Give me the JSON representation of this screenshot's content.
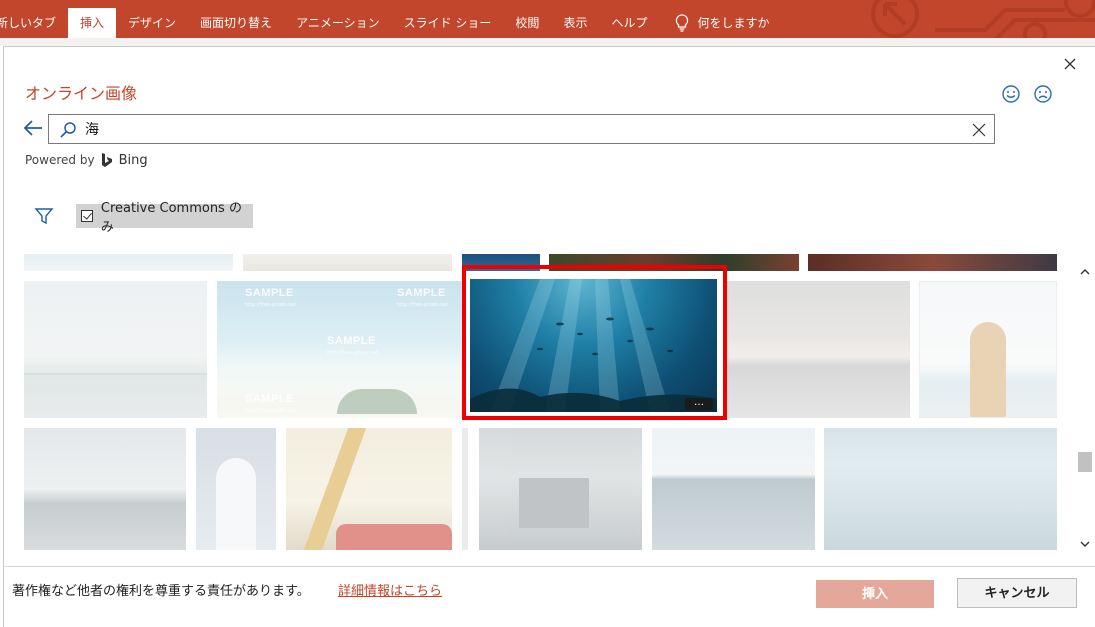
{
  "ribbon": {
    "tabs": [
      "新しいタブ",
      "挿入",
      "デザイン",
      "画面切り替え",
      "アニメーション",
      "スライド ショー",
      "校閲",
      "表示",
      "ヘルプ"
    ],
    "active_tab": "挿入",
    "tell_me": "何をしますか",
    "tell_me_icon": "lightbulb-icon",
    "accent_color": "#c2462b"
  },
  "dialog": {
    "title": "オンライン画像",
    "close_icon": "close-icon",
    "feedback_icons": [
      "smile-icon",
      "frown-icon"
    ],
    "search": {
      "value": "海",
      "placeholder": "",
      "icons": [
        "back-arrow-icon",
        "search-icon",
        "clear-icon"
      ]
    },
    "powered_by_label": "Powered by",
    "powered_by_brand": "Bing",
    "filter": {
      "icon": "filter-icon",
      "creative_commons_label": "Creative Commons のみ",
      "creative_commons_checked": true
    },
    "results": {
      "sample_watermark": "SAMPLE",
      "sample_url": "http://free-photo.net",
      "selected_index": 7,
      "more_button_label": "…",
      "highlight_color": "#ee0000"
    },
    "footer": {
      "rights_text": "著作権など他者の権利を尊重する責任があります。",
      "details_link": "詳細情報はこちら",
      "insert_label": "挿入",
      "cancel_label": "キャンセル"
    }
  }
}
